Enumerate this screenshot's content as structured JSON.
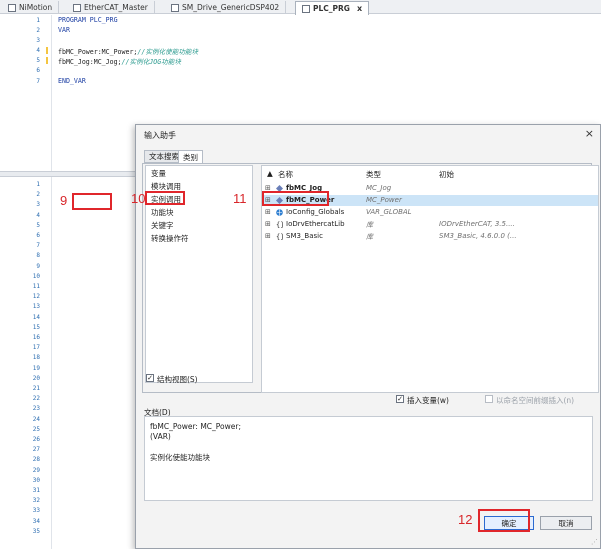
{
  "tabs": [
    {
      "label": "NiMotion",
      "icon": "project-icon"
    },
    {
      "label": "EtherCAT_Master",
      "icon": "device-icon"
    },
    {
      "label": "SM_Drive_GenericDSP402",
      "icon": "axis-icon"
    },
    {
      "label": "PLC_PRG",
      "icon": "pou-icon",
      "active": true,
      "close": "x"
    }
  ],
  "editor": {
    "line_numbers": [
      "1",
      "2",
      "3",
      "4",
      "5",
      "6",
      "7"
    ],
    "lines": [
      {
        "code": "PROGRAM PLC_PRG",
        "comment": ""
      },
      {
        "code": "VAR",
        "comment": ""
      },
      {
        "code": "",
        "comment": ""
      },
      {
        "code": "fbMC_Power:MC_Power;",
        "comment": "//实例化使能功能块"
      },
      {
        "code": "fbMC_Jog:MC_Jog;",
        "comment": "//实例化JOG功能块"
      },
      {
        "code": "",
        "comment": ""
      },
      {
        "code": "END_VAR",
        "comment": ""
      }
    ]
  },
  "body_line_numbers": [
    "1",
    "2",
    "3",
    "4",
    "5",
    "6",
    "7",
    "8",
    "9",
    "10",
    "11",
    "12",
    "13",
    "14",
    "15",
    "16",
    "17",
    "18",
    "19",
    "20",
    "21",
    "22",
    "23",
    "24",
    "25",
    "26",
    "27",
    "28",
    "29",
    "30",
    "31",
    "32",
    "33",
    "34",
    "35"
  ],
  "annotations": {
    "n9": "9",
    "n10": "10",
    "n11": "11",
    "n12": "12"
  },
  "dialog": {
    "title": "输入助手",
    "close": "×",
    "tabs": [
      {
        "label": "文本搜索"
      },
      {
        "label": "类别",
        "active": true
      }
    ],
    "categories": [
      "变量",
      "模块调用",
      "实例调用",
      "功能块",
      "关键字",
      "转换操作符"
    ],
    "selected_category": "实例调用",
    "columns": {
      "name": "名称",
      "type": "类型",
      "init": "初始"
    },
    "sort_icon": "▲",
    "rows": [
      {
        "expander": "⊞",
        "name": "fbMC_Jog",
        "type": "MC_Jog",
        "init": "",
        "icon": "function-block-icon",
        "bold": true
      },
      {
        "expander": "⊞",
        "name": "fbMC_Power",
        "type": "MC_Power",
        "init": "",
        "icon": "function-block-icon",
        "bold": true,
        "selected": true
      },
      {
        "expander": "⊞",
        "name": "IoConfig_Globals",
        "type": "VAR_GLOBAL",
        "init": "",
        "icon": "globe-icon"
      },
      {
        "expander": "⊞",
        "name": "IoDrvEthercatLib",
        "type": "库",
        "init": "IODrvEtherCAT, 3.5....",
        "icon": "library-icon"
      },
      {
        "expander": "⊞",
        "name": "SM3_Basic",
        "type": "库",
        "init": "SM3_Basic, 4.6.0.0 (...",
        "icon": "library-icon"
      }
    ],
    "structure_view": {
      "label": "结构视图(S)",
      "checked": true
    },
    "insert_variable": {
      "label": "插入变量(w)",
      "checked": true
    },
    "insert_namespace": {
      "label": "以命名空间前缀插入(n)",
      "checked": false
    },
    "doc_label": "文档(D)",
    "doc_lines": [
      "fbMC_Power: MC_Power;",
      "(VAR)",
      "",
      "实例化使能功能块"
    ],
    "ok": "确定",
    "cancel": "取消",
    "check_mark": "✓"
  },
  "colors": {
    "accent_red": "#e0262b",
    "selection": "#cce4f7",
    "keyword": "#1d3fa3",
    "comment": "#2a9a8e"
  }
}
